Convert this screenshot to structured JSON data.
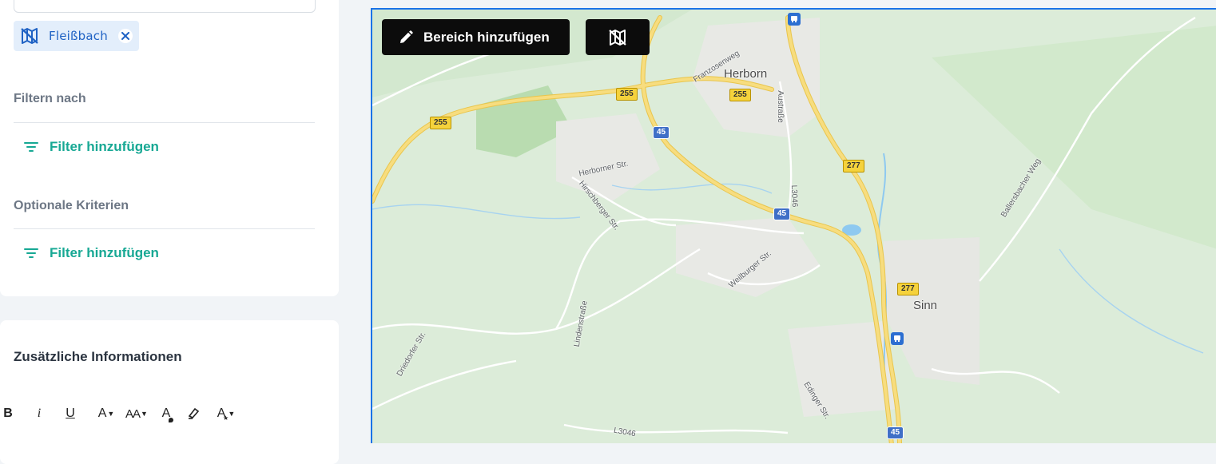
{
  "chip": {
    "label": "Fleißbach",
    "icon": "map-hidden-icon",
    "close_icon": "close-icon"
  },
  "filters": {
    "section_label": "Filtern nach",
    "add_label": "Filter hinzufügen",
    "icon": "filter-icon"
  },
  "optional": {
    "section_label": "Optionale Kriterien",
    "add_label": "Filter hinzufügen",
    "icon": "filter-icon"
  },
  "info": {
    "title": "Zusätzliche Informationen",
    "toolbar": [
      {
        "name": "bold-button",
        "label": "B"
      },
      {
        "name": "italic-button",
        "label": "i"
      },
      {
        "name": "underline-button",
        "label": "U"
      },
      {
        "name": "font-color-button",
        "label": "A"
      },
      {
        "name": "font-size-button",
        "label": "AA"
      },
      {
        "name": "text-color-button",
        "label": "A"
      },
      {
        "name": "highlight-button",
        "label": ""
      },
      {
        "name": "text-style-button",
        "label": "A"
      }
    ]
  },
  "map": {
    "add_area_label": "Bereich hinzufügen",
    "add_area_icon": "pencil-icon",
    "hide_icon": "map-hidden-icon",
    "places": {
      "herborn": "Herborn",
      "sinn": "Sinn"
    },
    "streets": {
      "franzosenweg": "Franzosenweg",
      "austrasse": "Austraße",
      "herborner": "Herborner Str.",
      "hirschberger": "Hirschberger Str.",
      "l3046_v": "L3046",
      "weilburger": "Weilburger Str.",
      "lindenstrasse": "Lindenstraße",
      "driedorfer": "Driedorfer Str.",
      "ballersbacher": "Ballersbacher Weg",
      "edinger": "Edinger Str.",
      "l3046_bottom": "L3046"
    },
    "road_shields": {
      "b255_a": "255",
      "b255_b": "255",
      "b255_c": "255",
      "a45_a": "45",
      "a45_b": "45",
      "a45_c": "45",
      "b277_a": "277",
      "b277_b": "277"
    },
    "colors": {
      "land": "#dceedb",
      "urban": "#e9eae6",
      "highway": "#f7d770",
      "water": "#8ec9f0",
      "border": "#1a73e8"
    }
  }
}
